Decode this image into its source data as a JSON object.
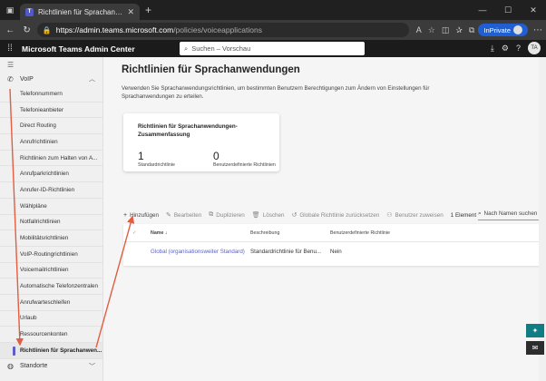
{
  "browser": {
    "tab_title": "Richtlinien für Sprachanwendungen",
    "url_host": "https://admin.teams.microsoft.com",
    "url_path": "/policies/voiceapplications",
    "inprivate_label": "InPrivate"
  },
  "app": {
    "name": "Microsoft Teams Admin Center",
    "search_placeholder": "Suchen – Vorschau",
    "user_initials": "TA"
  },
  "sidebar": {
    "group_voip": "VoIP",
    "items": [
      "Telefonnummern",
      "Telefonieanbieter",
      "Direct Routing",
      "Anrufrichtlinien",
      "Richtlinien zum Halten von A...",
      "Anrufparkrichtlinien",
      "Anrufer-ID-Richtlinien",
      "Wählpläne",
      "Notfallrichtlinien",
      "Mobilitätsrichtlinien",
      "VoIP-Routingrichtlinien",
      "Voicemailrichtlinien",
      "Automatische Telefonzentralen",
      "Anrufwarteschleifen",
      "Urlaub",
      "Ressourcenkonten",
      "Richtlinien für Sprachanwen..."
    ],
    "group_standorte": "Standorte"
  },
  "page": {
    "title": "Richtlinien für Sprachanwendungen",
    "description": "Verwenden Sie Sprachanwendungsrichtlinien, um bestimmten Benutzern Berechtigungen zum Ändern von Einstellungen für Sprachanwendungen zu erteilen."
  },
  "summary": {
    "title": "Richtlinien für Sprachanwendungen-Zusammenfassung",
    "standard_count": "1",
    "standard_label": "Standardrichtlinie",
    "custom_count": "0",
    "custom_label": "Benutzerdefinierte Richtlinien"
  },
  "toolbar": {
    "add": "Hinzufügen",
    "edit": "Bearbeiten",
    "duplicate": "Duplizieren",
    "delete": "Löschen",
    "reset_global": "Globale Richtlinie zurücksetzen",
    "assign_users": "Benutzer zuweisen",
    "count": "1 Element",
    "search_placeholder": "Nach Namen suchen"
  },
  "table": {
    "headers": {
      "name": "Name",
      "description": "Beschreibung",
      "custom": "Benutzerdefinierte Richtlinie"
    },
    "rows": [
      {
        "name": "Global (organisationsweiter Standard)",
        "description": "Standardrichtlinie für Benu...",
        "custom": "Nein"
      }
    ]
  },
  "colors": {
    "accent": "#5b5fc7",
    "arrow": "#e25d41"
  }
}
